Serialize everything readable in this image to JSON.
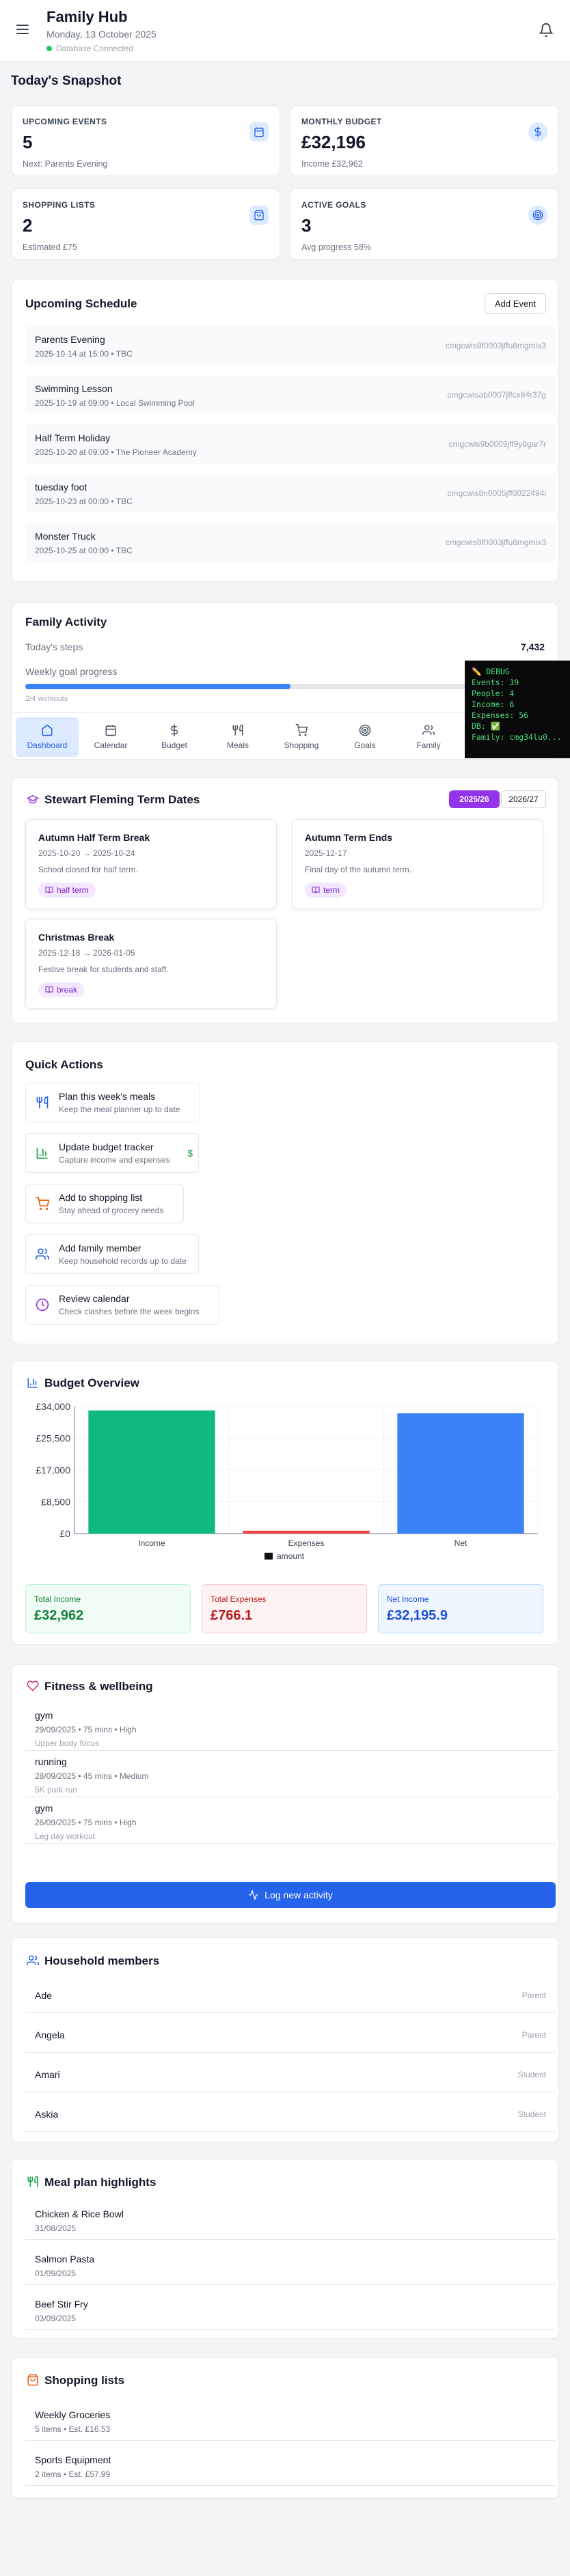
{
  "header": {
    "title": "Family Hub",
    "date": "Monday, 13 October 2025",
    "db_status": "Database Connected"
  },
  "snapshot": {
    "title": "Today's Snapshot",
    "stats": [
      {
        "label": "UPCOMING EVENTS",
        "value": "5",
        "sub": "Next: Parents Evening",
        "icon": "calendar-icon"
      },
      {
        "label": "MONTHLY BUDGET",
        "value": "£32,196",
        "sub": "Income £32,962",
        "icon": "dollar-icon"
      },
      {
        "label": "SHOPPING LISTS",
        "value": "2",
        "sub": "Estimated £75",
        "icon": "shopping-bag-icon"
      },
      {
        "label": "ACTIVE GOALS",
        "value": "3",
        "sub": "Avg progress 58%",
        "icon": "target-icon"
      }
    ]
  },
  "schedule": {
    "title": "Upcoming Schedule",
    "add_label": "Add Event",
    "items": [
      {
        "title": "Parents Evening",
        "meta": "2025-10-14 at 15:00 • TBC",
        "id": "cmgcwis8f0003jffu8mgmix3"
      },
      {
        "title": "Swimming Lesson",
        "meta": "2025-10-19 at 09:00 • Local Swimming Pool",
        "id": "cmgcwisab0007jffcx84r37g"
      },
      {
        "title": "Half Term Holiday",
        "meta": "2025-10-20 at 09:00 • The Pioneer Academy",
        "id": "cmgcwis9b0009jff9y0gar7r"
      },
      {
        "title": "tuesday foot",
        "meta": "2025-10-23 at 00:00 • TBC",
        "id": "cmgcwis8n0005jff0022494i"
      },
      {
        "title": "Monster Truck",
        "meta": "2025-10-25 at 00:00 • TBC",
        "id": "cmgcwis8f0003jffu8mgmix3"
      }
    ]
  },
  "activity": {
    "title": "Family Activity",
    "steps_label": "Today's steps",
    "steps_value": "7,432",
    "goal_label": "Weekly goal progress",
    "goal_progress": 0.5,
    "workouts": "2/4 workouts"
  },
  "nav": {
    "tabs": [
      {
        "label": "Dashboard",
        "icon": "home-icon"
      },
      {
        "label": "Calendar",
        "icon": "calendar-icon"
      },
      {
        "label": "Budget",
        "icon": "dollar-icon"
      },
      {
        "label": "Meals",
        "icon": "utensils-icon"
      },
      {
        "label": "Shopping",
        "icon": "cart-icon"
      },
      {
        "label": "Goals",
        "icon": "target-icon"
      },
      {
        "label": "Family",
        "icon": "users-icon"
      }
    ],
    "active": "Dashboard"
  },
  "debug": {
    "title": "✏️ DEBUG",
    "lines": [
      "Events: 39",
      "People: 4",
      "Income: 6",
      "Expenses: 56",
      "DB: ✅",
      "Family: cmg34lu0..."
    ]
  },
  "term_dates": {
    "title": "Stewart Fleming Term Dates",
    "years": [
      "2025/26",
      "2026/27"
    ],
    "active_year": "2025/26",
    "items": [
      {
        "title": "Autumn Half Term Break",
        "dates": "2025-10-20 → 2025-10-24",
        "desc": "School closed for half term.",
        "tag": "half term"
      },
      {
        "title": "Autumn Term Ends",
        "dates": "2025-12-17",
        "desc": "Final day of the autumn term.",
        "tag": "term"
      },
      {
        "title": "Christmas Break",
        "dates": "2025-12-18 → 2026-01-05",
        "desc": "Festive break for students and staff.",
        "tag": "break"
      }
    ]
  },
  "quick_actions": {
    "title": "Quick Actions",
    "items": [
      {
        "title": "Plan this week's meals",
        "desc": "Keep the meal planner up to date",
        "icon": "utensils-icon",
        "color": "#2563eb"
      },
      {
        "title": "Update budget tracker",
        "desc": "Capture income and expenses",
        "icon": "chart-icon",
        "color": "#16a34a"
      },
      {
        "title": "Add to shopping list",
        "desc": "Stay ahead of grocery needs",
        "icon": "cart-icon",
        "color": "#ea580c"
      },
      {
        "title": "Add family member",
        "desc": "Keep household records up to date",
        "icon": "users-icon",
        "color": "#2563eb"
      },
      {
        "title": "Review calendar",
        "desc": "Check clashes before the week begins",
        "icon": "clock-icon",
        "color": "#9333ea"
      }
    ],
    "budget_symbol": "$"
  },
  "budget": {
    "title": "Budget Overview",
    "totals": [
      {
        "label": "Total Income",
        "value": "£32,962",
        "bg": "#f0fdf4",
        "border": "#bbf7d0",
        "color": "#15803d"
      },
      {
        "label": "Total Expenses",
        "value": "£766.1",
        "bg": "#fef2f2",
        "border": "#fecaca",
        "color": "#b91c1c"
      },
      {
        "label": "Net Income",
        "value": "£32,195.9",
        "bg": "#eff6ff",
        "border": "#bfdbfe",
        "color": "#1d4ed8"
      }
    ]
  },
  "chart_data": {
    "type": "bar",
    "categories": [
      "Income",
      "Expenses",
      "Net"
    ],
    "values": [
      32962,
      766.1,
      32195.9
    ],
    "colors": [
      "#10b981",
      "#ef4444",
      "#3b82f6"
    ],
    "ylim": [
      0,
      34000
    ],
    "yticks": [
      "£0",
      "£8,500",
      "£17,000",
      "£25,500",
      "£34,000"
    ],
    "legend": "amount",
    "grid": true
  },
  "fitness": {
    "title": "Fitness & wellbeing",
    "items": [
      {
        "title": "gym",
        "meta": "29/09/2025 • 75 mins • High",
        "note": "Upper body focus"
      },
      {
        "title": "running",
        "meta": "28/09/2025 • 45 mins • Medium",
        "note": "5K park run"
      },
      {
        "title": "gym",
        "meta": "26/09/2025 • 75 mins • High",
        "note": "Leg day workout"
      }
    ],
    "log_label": "Log new activity"
  },
  "household": {
    "title": "Household members",
    "members": [
      {
        "name": "Ade",
        "role": "Parent"
      },
      {
        "name": "Angela",
        "role": "Parent"
      },
      {
        "name": "Amari",
        "role": "Student"
      },
      {
        "name": "Askia",
        "role": "Student"
      }
    ]
  },
  "meals": {
    "title": "Meal plan highlights",
    "items": [
      {
        "name": "Chicken & Rice Bowl",
        "date": "31/08/2025"
      },
      {
        "name": "Salmon Pasta",
        "date": "01/09/2025"
      },
      {
        "name": "Beef Stir Fry",
        "date": "03/09/2025"
      }
    ]
  },
  "shopping": {
    "title": "Shopping lists",
    "items": [
      {
        "name": "Weekly Groceries",
        "meta": "5 items • Est. £16.53"
      },
      {
        "name": "Sports Equipment",
        "meta": "2 items • Est. £57.99"
      }
    ]
  }
}
